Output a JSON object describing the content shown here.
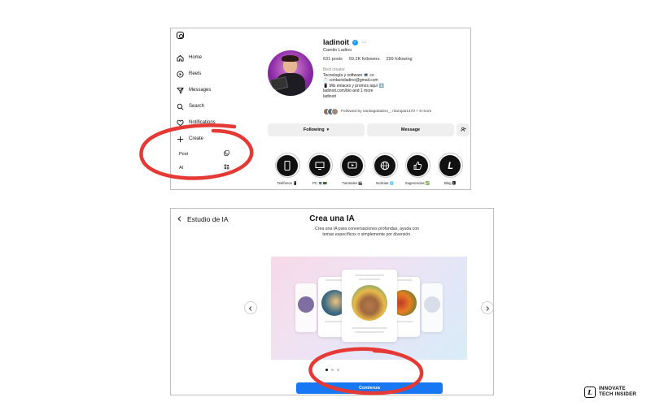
{
  "instagram": {
    "nav": [
      {
        "label": "Home",
        "icon": "home-icon"
      },
      {
        "label": "Reels",
        "icon": "reels-icon"
      },
      {
        "label": "Messages",
        "icon": "messages-icon"
      },
      {
        "label": "Search",
        "icon": "search-icon"
      },
      {
        "label": "Notifications",
        "icon": "heart-icon"
      },
      {
        "label": "Create",
        "icon": "plus-icon"
      }
    ],
    "create_menu": [
      {
        "label": "Post",
        "icon": "post-icon"
      },
      {
        "label": "AI",
        "icon": "ai-icon"
      }
    ],
    "profile": {
      "username": "ladinoit",
      "full_name": "Camilo Ladino",
      "posts": "631 posts",
      "followers": "59.2K followers",
      "following": "299 following",
      "category": "Best creator",
      "bio_line1": "Tecnología y software 💻 co",
      "bio_line2": "📩 contactoladino@gmail.com",
      "bio_line3": "📱 Mis enlaces y promos aquí ⬇️",
      "link": "ladinoit.com/bio and 1 more",
      "threads": "ladinoit",
      "followed_by": "Followed by santiagoladino_, ritarojas1470 + 8 more"
    },
    "buttons": {
      "following": "Following",
      "message": "Message"
    },
    "highlights": [
      {
        "label": "Teléfonos 📱"
      },
      {
        "label": "PC 💻📟"
      },
      {
        "label": "Tutoriales 🎬"
      },
      {
        "label": "Noticias 🌐"
      },
      {
        "label": "Sugerencias ✅"
      },
      {
        "label": "Blog 🅻"
      }
    ]
  },
  "ai_studio": {
    "back_label": "Estudio de IA",
    "title": "Crea una IA",
    "description": "Crea una IA para conversaciones profundas, ayuda con temas específicos o simplemente por diversión.",
    "start_button": "Comienza",
    "carousel_dots": 3,
    "active_dot": 1
  },
  "colors": {
    "annotation": "#e53935",
    "primary_button": "#1877f2",
    "verified": "#1d9bf0"
  },
  "brand": {
    "line1": "INNOVATE",
    "line2": "TECH INSIDER"
  }
}
